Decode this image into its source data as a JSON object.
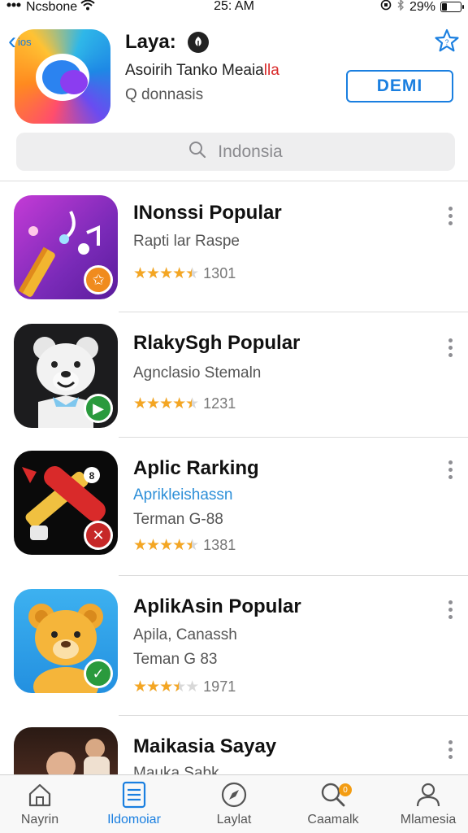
{
  "status_bar": {
    "carrier": "Ncsbone",
    "time": "25: AM",
    "battery_text": "29%",
    "battery_level": 0.29
  },
  "header": {
    "back_label": "ios",
    "title": "Laya:",
    "subtitle_main": "Asoirih Tanko Meaia",
    "subtitle_accent": "lla",
    "search_hint": "Q donnasis",
    "action_button": "DEMI"
  },
  "search": {
    "placeholder": "Indonsia"
  },
  "apps": [
    {
      "title": "INonssi Popular",
      "lines": [
        {
          "text": "Rapti lar Raspe",
          "style": "gray"
        }
      ],
      "rating": 4.5,
      "count": "1301"
    },
    {
      "title": "RlakySgh Popular",
      "lines": [
        {
          "text": "Agnclasio Stemaln",
          "style": "gray"
        }
      ],
      "rating": 4.5,
      "count": "1231"
    },
    {
      "title": "Aplic Rarking",
      "lines": [
        {
          "text": "Aprikleishassn",
          "style": "blue"
        },
        {
          "text": "Terman G-88",
          "style": "gray"
        }
      ],
      "rating": 4.5,
      "count": "1381"
    },
    {
      "title": "AplikAsin Popular",
      "lines": [
        {
          "text": "Apila, Canassh",
          "style": "gray"
        },
        {
          "text": "Teman G 83",
          "style": "gray"
        }
      ],
      "rating": 3.5,
      "count": "1971"
    },
    {
      "title": "Maikasia Sayay",
      "lines": [
        {
          "text": "Mauka Sabk",
          "style": "gray"
        }
      ],
      "rating": 0,
      "count": ""
    }
  ],
  "tabs": [
    {
      "label": "Nayrin",
      "icon": "home-icon"
    },
    {
      "label": "Ildomoiar",
      "icon": "list-icon",
      "active": true
    },
    {
      "label": "Laylat",
      "icon": "compass-icon"
    },
    {
      "label": "Caamalk",
      "icon": "search-icon",
      "badge": "0"
    },
    {
      "label": "Mlamesia",
      "icon": "person-icon"
    }
  ],
  "colors": {
    "accent": "#1a7fe0",
    "star": "#f4a623",
    "link_blue": "#2d8fd8"
  }
}
